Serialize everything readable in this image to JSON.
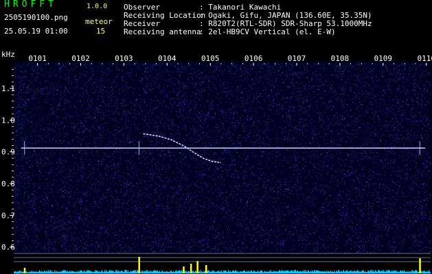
{
  "header": {
    "brand": "HROFFT",
    "version": "1.0.0",
    "filename": "2505190100.png",
    "datetime": "25.05.19 01:00",
    "meteor_label": "meteor",
    "meteor_count": "15",
    "info": [
      {
        "label": "Observer",
        "value": ": Takanori Kawachi"
      },
      {
        "label": "Receiving Location",
        "value": ": Ogaki, Gifu, JAPAN (136.60E, 35.35N)"
      },
      {
        "label": "Receiver",
        "value": ": R820T2(RTL-SDR) SDR-Sharp 53.1000MHz"
      },
      {
        "label": "Receiving antenna",
        "value": ": 2el-HB9CV Vertical (el. E-W)"
      }
    ]
  },
  "chart_data": {
    "type": "heatmap",
    "ylabel": "kHz",
    "x_ticks": [
      "0101",
      "0102",
      "0103",
      "0104",
      "0105",
      "0106",
      "0107",
      "0108",
      "0109",
      "0110"
    ],
    "y_ticks": [
      1.1,
      1.0,
      0.9,
      0.8,
      0.7,
      0.6
    ],
    "y_tick_labels": [
      "1.1",
      "1.0",
      "0.9",
      "0.8",
      "0.7",
      "0.6"
    ],
    "ylim": [
      0.58,
      1.18
    ],
    "xlim_minutes": [
      0.45,
      10.1
    ],
    "carrier_freq_khz": 0.912,
    "meteor_trace": [
      {
        "t": 3.45,
        "f": 0.957
      },
      {
        "t": 3.8,
        "f": 0.95
      },
      {
        "t": 4.1,
        "f": 0.938
      },
      {
        "t": 4.4,
        "f": 0.918
      },
      {
        "t": 4.65,
        "f": 0.895
      },
      {
        "t": 4.85,
        "f": 0.879
      },
      {
        "t": 5.05,
        "f": 0.87
      },
      {
        "t": 5.25,
        "f": 0.866
      }
    ],
    "vertical_events_minutes": [
      0.7,
      3.35,
      9.85
    ],
    "colors": {
      "background": "#000022",
      "noise": "#1a2a8a",
      "signal": "#ccd8ff",
      "ticks": "#ffffff",
      "power_bar": "#00ccff",
      "power_peak": "#ffff00"
    }
  }
}
